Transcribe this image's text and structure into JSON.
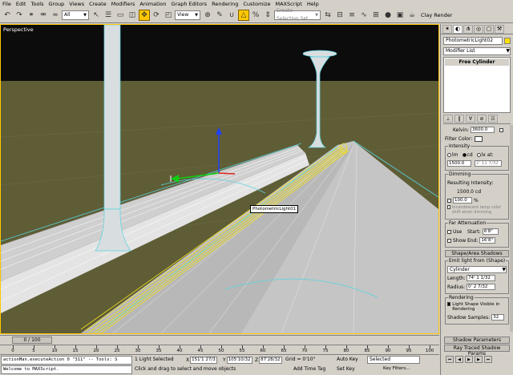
{
  "menu": [
    "File",
    "Edit",
    "Tools",
    "Group",
    "Views",
    "Create",
    "Modifiers",
    "Animation",
    "Graph Editors",
    "Rendering",
    "Customize",
    "MAXScript",
    "Help"
  ],
  "toolbar": {
    "filter_select": "All",
    "coord_select": "View",
    "named_selection_placeholder": "Create Selection Set",
    "clay_render": "Clay Render"
  },
  "viewport": {
    "label": "Perspective",
    "object_label": "PhotometricLight01"
  },
  "command_panel": {
    "object_name": "PhotometricLight02",
    "modifier_list": "Modifier List",
    "stack_item": "Free Cylinder",
    "kelvin_label": "Kelvin:",
    "kelvin_value": "3600.0",
    "filter_color_label": "Filter Color:",
    "intensity": {
      "title": "Intensity",
      "lm": "lm",
      "cd": "cd",
      "lx_at": "lx at:",
      "value": "1500.0",
      "dist": "2' 11 7/32"
    },
    "dimming": {
      "title": "Dimming",
      "resulting_label": "Resulting Intensity:",
      "resulting_value": "1500.0 cd",
      "percent_value": "100.0",
      "percent_unit": "%",
      "incandescent": "Incandescent lamp color shift when dimming"
    },
    "far_attenuation": {
      "title": "Far Attenuation",
      "use": "Use",
      "show": "Show",
      "start_label": "Start:",
      "start_value": "6'8\"",
      "end_label": "End:",
      "end_value": "16'8\""
    },
    "shape_rollout": "Shape/Area Shadows",
    "emit": {
      "title": "Emit light from (Shape)",
      "shape": "Cylinder",
      "length_label": "Length:",
      "length_value": "74' 1 1/32",
      "radius_label": "Radius:",
      "radius_value": "0' 2 7/32"
    },
    "rendering": {
      "title": "Rendering",
      "visible": "Light Shape Visible in Rendering",
      "samples_label": "Shadow Samples:",
      "samples_value": "32"
    },
    "shadow_params": "Shadow Parameters",
    "ray_traced": "Ray Traced Shadow Params"
  },
  "timeline": {
    "slider": "0 / 100",
    "ticks": [
      "0",
      "5",
      "10",
      "15",
      "20",
      "25",
      "30",
      "35",
      "40",
      "45",
      "50",
      "55",
      "60",
      "65",
      "70",
      "75",
      "80",
      "85",
      "90",
      "95",
      "100"
    ]
  },
  "status": {
    "maxscript_1": "actionMan.executeAction 0 \"311\"  -- Tools: S",
    "maxscript_2": "Welcome to MAXScript.",
    "selected": "1 Light Selected",
    "prompt": "Click and drag to select and move objects",
    "x_label": "X",
    "x_value": "151'1 27/3",
    "y_label": "Y",
    "y_value": "105'10/32",
    "z_label": "Z",
    "z_value": "87'28/32",
    "grid": "Grid = 0'10\"",
    "add_time_tag": "Add Time Tag",
    "auto_key": "Auto Key",
    "set_key": "Set Key",
    "selected_dropdown": "Selected",
    "key_filters": "Key Filters..."
  }
}
